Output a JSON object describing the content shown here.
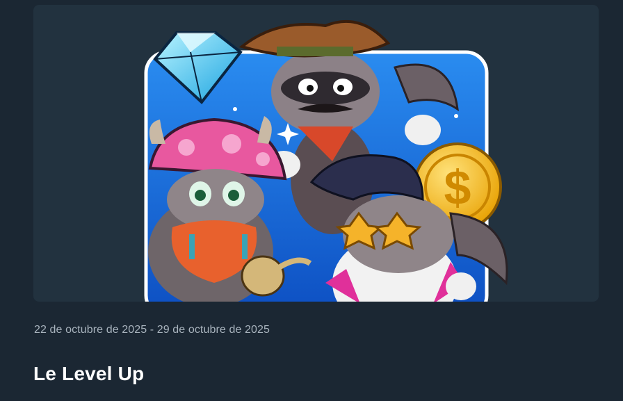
{
  "event": {
    "image_name": "raccoon-characters-promo-art",
    "date_range": "22 de octubre de 2025 - 29 de octubre de 2025",
    "title": "Le Level Up"
  },
  "colors": {
    "page_bg": "#1b2733",
    "card_bg": "#22323f",
    "date_text": "#a8b3bd",
    "title_text": "#ffffff",
    "art_blue": "#1565d8"
  }
}
